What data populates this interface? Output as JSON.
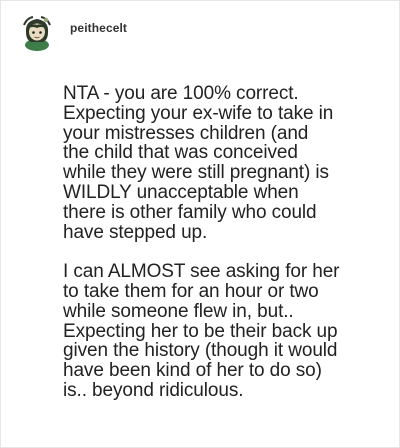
{
  "post": {
    "username": "peithecelt",
    "avatar_icon": "cartoon-character-avatar-icon",
    "paragraphs": [
      "NTA - you are 100% correct.\nExpecting your ex-wife to take in\nyour mistresses children (and\nthe child that was conceived\nwhile they were still pregnant) is\nWILDLY unacceptable when\nthere is other family who could\nhave stepped up.",
      "I can ALMOST see asking for her\nto take them for an hour or two\nwhile someone flew in, but..\nExpecting her to be their back up\ngiven the history (though it would\nhave been kind of her to do so)\nis.. beyond ridiculous."
    ]
  },
  "colors": {
    "background": "#ffffff",
    "text": "#222222",
    "username": "#333333",
    "avatar_skin": "#d9c9a8",
    "avatar_hair": "#2f3b2a",
    "avatar_cloth": "#3e7d4a"
  }
}
